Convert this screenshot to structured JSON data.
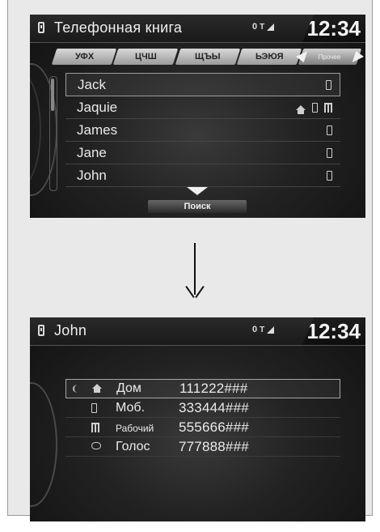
{
  "screen1": {
    "title": "Телефонная книга",
    "status": "0",
    "clock": "12:34",
    "tabs": [
      "УФХ",
      "ЦЧШ",
      "ЩЪЫ",
      "ЬЭЮЯ"
    ],
    "more_label": "Прочее",
    "contacts": [
      {
        "name": "Jack",
        "icons": [
          "phone-icon"
        ]
      },
      {
        "name": "Jaquie",
        "icons": [
          "home-icon",
          "phone-icon",
          "work-icon"
        ]
      },
      {
        "name": "James",
        "icons": [
          "phone-icon"
        ]
      },
      {
        "name": "Jane",
        "icons": [
          "phone-icon"
        ]
      },
      {
        "name": "John",
        "icons": [
          "phone-icon"
        ]
      }
    ],
    "search_label": "Поиск"
  },
  "screen2": {
    "title": "John",
    "status": "0",
    "clock": "12:34",
    "numbers": [
      {
        "label": "Дом",
        "number": "111222###",
        "icon": "home-icon"
      },
      {
        "label": "Моб.",
        "number": "333444###",
        "icon": "mobile-icon"
      },
      {
        "label": "Рабочий",
        "number": "555666###",
        "icon": "work-icon"
      },
      {
        "label": "Голос",
        "number": "777888###",
        "icon": "voice-icon"
      }
    ]
  },
  "colors": {
    "screen_bg": "#141414",
    "text": "#eaeaea",
    "frame": "#e9e9e9"
  }
}
